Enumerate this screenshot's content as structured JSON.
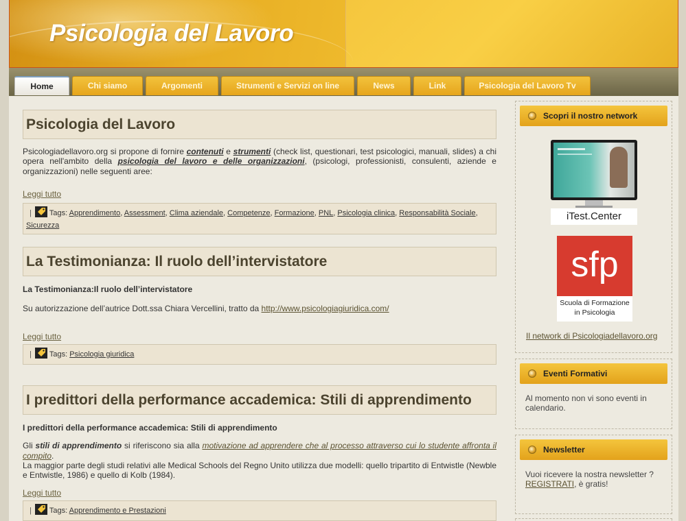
{
  "header": {
    "title": "Psicologia del Lavoro"
  },
  "nav": {
    "tabs": [
      {
        "label": "Home"
      },
      {
        "label": "Chi siamo"
      },
      {
        "label": "Argomenti"
      },
      {
        "label": "Strumenti e Servizi on line"
      },
      {
        "label": "News"
      },
      {
        "label": "Link"
      },
      {
        "label": "Psicologia del Lavoro Tv"
      }
    ]
  },
  "posts": [
    {
      "title": "Psicologia del Lavoro",
      "text_parts": [
        "Psicologiadellavoro.org si propone di fornire ",
        "contenuti",
        " e ",
        "strumenti",
        " (check list, questionari, test psicologici, manuali, slides) a chi opera nell'ambito della ",
        "psicologia del lavoro e delle organizzazioni",
        ", (psicologi, professionisti, consulenti, aziende e organizzazioni) nelle seguenti aree:"
      ],
      "readmore": "Leggi tutto",
      "tags_label": "Tags:",
      "tags": [
        "Apprendimento",
        "Assessment",
        "Clima aziendale",
        "Competenze",
        "Formazione",
        "PNL",
        "Psicologia clinica",
        "Responsabilità Sociale",
        "Sicurezza"
      ],
      "separator": "|"
    },
    {
      "title": "La Testimonianza: Il ruolo dell’intervistatore",
      "subtitle": "La Testimonianza:Il ruolo dell’intervistatore",
      "text_before_link": "Su autorizzazione dell’autrice Dott.ssa Chiara Vercellini, tratto da ",
      "link": "http://www.psicologiagiuridica.com/",
      "readmore": "Leggi tutto",
      "tags_label": "Tags:",
      "tags": [
        "Psicologia giuridica"
      ],
      "separator": "|"
    },
    {
      "title": "I predittori della performance accademica: Stili di apprendimento",
      "subtitle": "I predittori della performance accademica: Stili di apprendimento",
      "text_parts": [
        "Gli ",
        "stili di apprendimento",
        " si riferiscono sia alla ",
        "motivazione ad apprendere che al processo attraverso cui lo studente affronta il compito",
        "."
      ],
      "text2": "La maggior parte degli studi relativi alle Medical Schools del Regno Unito utilizza due modelli: quello tripartito di Entwistle (Newble e Entwistle, 1986) e quello di Kolb (1984).",
      "readmore": "Leggi tutto",
      "tags_label": "Tags:",
      "tags": [
        "Apprendimento e Prestazioni"
      ],
      "separator": "|"
    }
  ],
  "sidebar": {
    "network": {
      "title": "Scopri il nostro network",
      "itest_caption": "iTest.Center",
      "sfp_logo": "sfp",
      "sfp_caption_1": "Scuola di Formazione",
      "sfp_caption_2": "in Psicologia",
      "link": "Il network di Psicologiadellavoro.org"
    },
    "events": {
      "title": "Eventi Formativi",
      "text": "Al momento non vi sono eventi in calendario."
    },
    "newsletter": {
      "title": "Newsletter",
      "text": "Vuoi ricevere la nostra newsletter ?",
      "link": "REGISTRATI",
      "suffix": ", è gratis!"
    }
  },
  "colors": {
    "accent": "#f0b82e",
    "nav_bg": "#7d765a",
    "content_bg": "#edeae0"
  }
}
